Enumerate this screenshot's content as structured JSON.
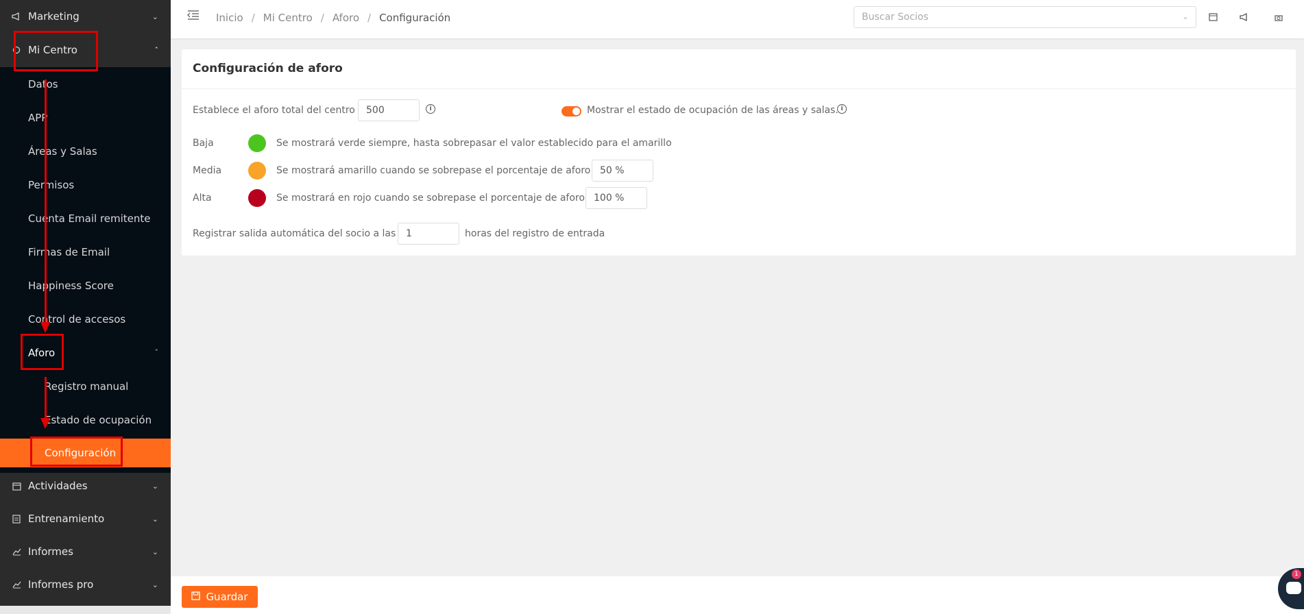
{
  "sidebar": {
    "marketing": "Marketing",
    "mi_centro": "Mi Centro",
    "items": [
      "Datos",
      "APP",
      "Áreas y Salas",
      "Permisos",
      "Cuenta Email remitente",
      "Firmas de Email",
      "Happiness Score",
      "Control de accesos"
    ],
    "aforo": "Aforo",
    "aforo_items": [
      "Registro manual",
      "Estado de ocupación",
      "Configuración"
    ],
    "actividades": "Actividades",
    "entrenamiento": "Entrenamiento",
    "informes": "Informes",
    "informes_pro": "Informes pro"
  },
  "topbar": {
    "breadcrumb": [
      "Inicio",
      "Mi Centro",
      "Aforo",
      "Configuración"
    ],
    "search_placeholder": "Buscar Socios"
  },
  "card": {
    "title": "Configuración de aforo",
    "total_label": "Establece el aforo total del centro",
    "total_value": "500",
    "toggle_label": "Mostrar el estado de ocupación de las áreas y salas.",
    "toggle_on": true,
    "levels": [
      {
        "name": "Baja",
        "color": "#4cc51f",
        "text": "Se mostrará verde siempre, hasta sobrepasar el valor establecido para el amarillo"
      },
      {
        "name": "Media",
        "color": "#f7a428",
        "text": "Se mostrará amarillo cuando se sobrepase el porcentaje de aforo",
        "value": "50 %"
      },
      {
        "name": "Alta",
        "color": "#b8001f",
        "text": "Se mostrará en rojo cuando se sobrepase el porcentaje de aforo",
        "value": "100 %"
      }
    ],
    "exit_label_before": "Registrar salida automática del socio a las",
    "exit_value": "1",
    "exit_label_after": "horas del registro de entrada"
  },
  "footer": {
    "save_label": "Guardar"
  },
  "chat": {
    "badge": "1"
  }
}
